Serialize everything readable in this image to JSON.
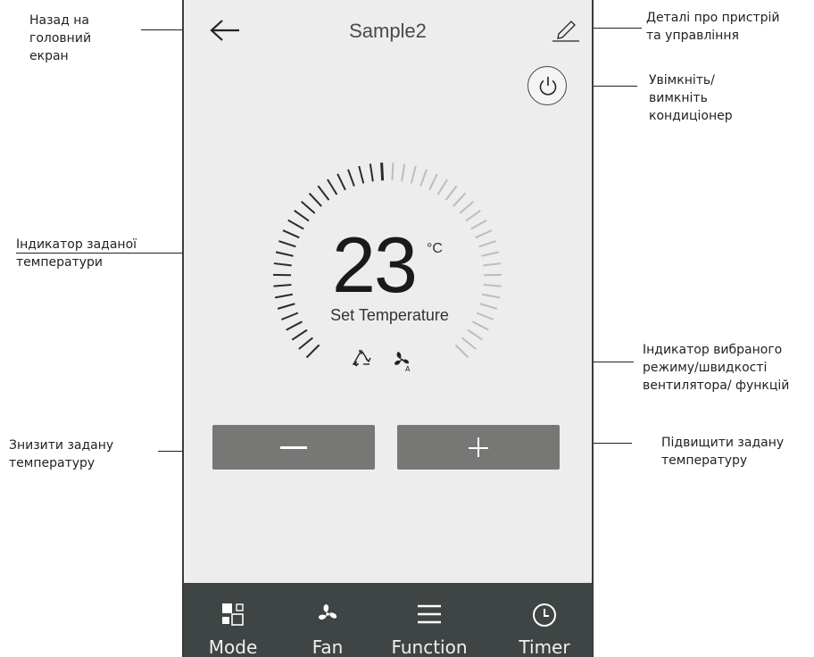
{
  "header": {
    "title": "Sample2"
  },
  "thermostat": {
    "temperature": "23",
    "unit": "°C",
    "label": "Set Temperature",
    "level": 0.5
  },
  "tabs": [
    {
      "label": "Mode",
      "icon": "mode-icon"
    },
    {
      "label": "Fan",
      "icon": "fan-icon"
    },
    {
      "label": "Function",
      "icon": "menu-icon"
    },
    {
      "label": "Timer",
      "icon": "clock-icon"
    }
  ],
  "annotations": {
    "back": [
      "Назад на",
      "головний",
      "екран"
    ],
    "details": [
      "Деталі про пристрій",
      "та управління"
    ],
    "power": [
      "Увімкніть/",
      "вимкніть",
      "кондиціонер"
    ],
    "set_temp": [
      "Індикатор заданої",
      "температури"
    ],
    "mode_indicator": [
      "Індикатор вибраного",
      "режиму/швидкості",
      "вентилятора/ функцій"
    ],
    "decrease": [
      "Знизити задану",
      "температуру"
    ],
    "increase": [
      "Підвищити задану",
      "температуру"
    ]
  },
  "colors": {
    "screen_bg": "#ededed",
    "button": "#777876",
    "bottom_bar": "#3e4544",
    "tick_active": "#2b2b2b",
    "tick_inactive": "#bdbdbd"
  }
}
